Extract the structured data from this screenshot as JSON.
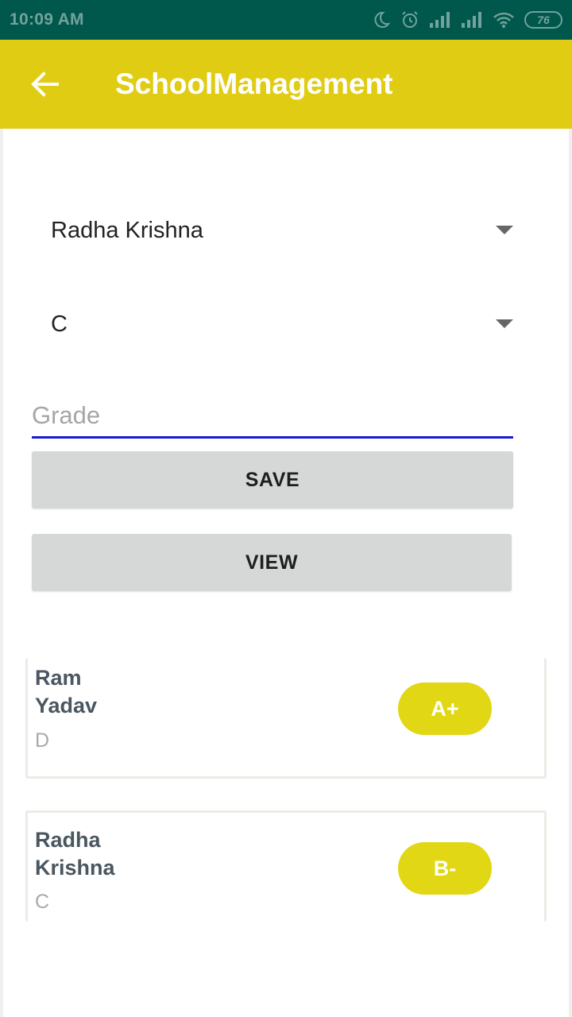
{
  "status_bar": {
    "time": "10:09 AM",
    "battery": "76"
  },
  "app_bar": {
    "title": "SchoolManagement",
    "back_icon": "arrow-left-icon"
  },
  "form": {
    "student_spinner_value": "Radha Krishna",
    "section_spinner_value": "C",
    "grade_input": {
      "placeholder": "Grade",
      "value": ""
    },
    "save_label": "SAVE",
    "view_label": "VIEW"
  },
  "records": [
    {
      "first_name": "Ram",
      "last_name": "Yadav",
      "section": "D",
      "grade": "A+"
    },
    {
      "first_name": "Radha",
      "last_name": "Krishna",
      "section": "C",
      "grade": "B-"
    }
  ],
  "colors": {
    "status_bar": "#00574b",
    "app_bar": "#e1cc14",
    "badge": "#e1d714",
    "input_underline": "#1a1ad6",
    "button": "#d6d7d7"
  }
}
